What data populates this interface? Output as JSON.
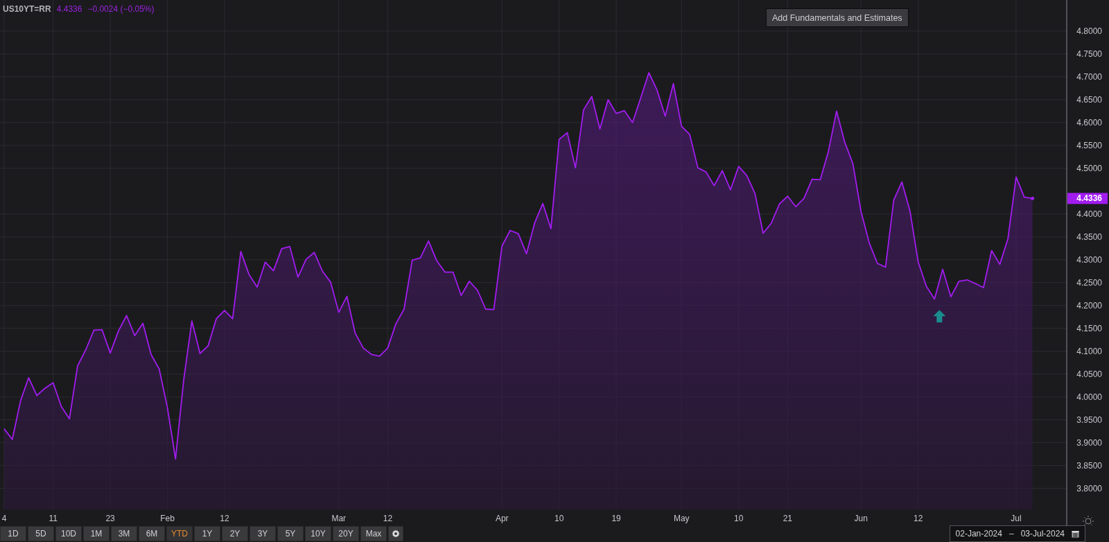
{
  "header": {
    "last": "4.4336",
    "change": "−0.0024 (−0.05%)"
  },
  "tooltip_button": {
    "label": "Add Fundamentals and Estimates"
  },
  "chart": {
    "price_tag": "4.4336",
    "chart_data": {
      "type": "area",
      "grid": true,
      "categories": [
        "4",
        null,
        null,
        null,
        null,
        null,
        "11",
        null,
        null,
        null,
        null,
        null,
        null,
        "23",
        null,
        null,
        null,
        null,
        null,
        null,
        "Feb",
        null,
        null,
        null,
        null,
        null,
        null,
        "12",
        null,
        null,
        null,
        null,
        null,
        null,
        null,
        null,
        null,
        null,
        null,
        null,
        null,
        "Mar",
        null,
        null,
        null,
        null,
        null,
        "12",
        null,
        null,
        null,
        null,
        null,
        null,
        null,
        null,
        null,
        null,
        null,
        null,
        null,
        "Apr",
        null,
        null,
        null,
        null,
        null,
        null,
        "10",
        null,
        null,
        null,
        null,
        null,
        null,
        "19",
        null,
        null,
        null,
        null,
        null,
        null,
        null,
        "May",
        null,
        null,
        null,
        null,
        null,
        null,
        "10",
        null,
        null,
        null,
        null,
        null,
        "21",
        null,
        null,
        null,
        null,
        null,
        null,
        null,
        null,
        "Jun",
        null,
        null,
        null,
        null,
        null,
        null,
        "12",
        null,
        null,
        null,
        null,
        null,
        null,
        null,
        null,
        null,
        null,
        null,
        "Jul",
        null,
        null
      ],
      "ylim": [
        3.754,
        4.868
      ],
      "yticks": [
        {
          "value": 4.8,
          "label": "4.8000"
        },
        {
          "value": 4.75,
          "label": "4.7500"
        },
        {
          "value": 4.7,
          "label": "4.7000"
        },
        {
          "value": 4.65,
          "label": "4.6500"
        },
        {
          "value": 4.6,
          "label": "4.6000"
        },
        {
          "value": 4.55,
          "label": "4.5500"
        },
        {
          "value": 4.5,
          "label": "4.5000"
        },
        {
          "value": 4.4,
          "label": "4.4000"
        },
        {
          "value": 4.35,
          "label": "4.3500"
        },
        {
          "value": 4.3,
          "label": "4.3000"
        },
        {
          "value": 4.25,
          "label": "4.2500"
        },
        {
          "value": 4.2,
          "label": "4.2000"
        },
        {
          "value": 4.15,
          "label": "4.1500"
        },
        {
          "value": 4.1,
          "label": "4.1000"
        },
        {
          "value": 4.05,
          "label": "4.0500"
        },
        {
          "value": 4.0,
          "label": "4.0000"
        },
        {
          "value": 3.95,
          "label": "3.9500"
        },
        {
          "value": 3.9,
          "label": "3.9000"
        },
        {
          "value": 3.85,
          "label": "3.8500"
        },
        {
          "value": 3.8,
          "label": "3.8000"
        }
      ],
      "series": [
        {
          "name": "US10YT=RR",
          "color": "#a21cf0",
          "values": [
            3.93,
            3.907,
            3.991,
            4.042,
            4.003,
            4.019,
            4.031,
            3.979,
            3.952,
            4.068,
            4.103,
            4.146,
            4.147,
            4.096,
            4.144,
            4.178,
            4.134,
            4.161,
            4.093,
            4.061,
            3.977,
            3.864,
            4.037,
            4.166,
            4.095,
            4.112,
            4.171,
            4.189,
            4.171,
            4.318,
            4.268,
            4.24,
            4.295,
            4.276,
            4.324,
            4.329,
            4.262,
            4.301,
            4.316,
            4.275,
            4.251,
            4.185,
            4.22,
            4.14,
            4.107,
            4.093,
            4.089,
            4.107,
            4.16,
            4.192,
            4.299,
            4.304,
            4.341,
            4.298,
            4.273,
            4.273,
            4.222,
            4.253,
            4.233,
            4.192,
            4.191,
            4.33,
            4.364,
            4.357,
            4.313,
            4.38,
            4.423,
            4.368,
            4.563,
            4.578,
            4.501,
            4.628,
            4.657,
            4.586,
            4.65,
            4.62,
            4.626,
            4.6,
            4.654,
            4.709,
            4.671,
            4.614,
            4.685,
            4.592,
            4.574,
            4.501,
            4.492,
            4.462,
            4.495,
            4.453,
            4.504,
            4.484,
            4.445,
            4.358,
            4.38,
            4.422,
            4.439,
            4.416,
            4.434,
            4.476,
            4.475,
            4.537,
            4.625,
            4.557,
            4.51,
            4.405,
            4.337,
            4.292,
            4.284,
            4.43,
            4.47,
            4.406,
            4.295,
            4.242,
            4.214,
            4.279,
            4.219,
            4.253,
            4.256,
            4.248,
            4.239,
            4.32,
            4.29,
            4.346,
            4.481,
            4.437,
            4.434
          ]
        }
      ]
    }
  },
  "range_buttons": [
    {
      "label": "1D",
      "selected": false
    },
    {
      "label": "5D",
      "selected": false
    },
    {
      "label": "10D",
      "selected": false
    },
    {
      "label": "1M",
      "selected": false
    },
    {
      "label": "3M",
      "selected": false
    },
    {
      "label": "6M",
      "selected": false
    },
    {
      "label": "YTD",
      "selected": true
    },
    {
      "label": "1Y",
      "selected": false
    },
    {
      "label": "2Y",
      "selected": false
    },
    {
      "label": "3Y",
      "selected": false
    },
    {
      "label": "5Y",
      "selected": false
    },
    {
      "label": "10Y",
      "selected": false
    },
    {
      "label": "20Y",
      "selected": false
    },
    {
      "label": "Max",
      "selected": false
    }
  ],
  "date_range": {
    "start": "02-Jan-2024",
    "separator": "–",
    "end": "03-Jul-2024"
  }
}
